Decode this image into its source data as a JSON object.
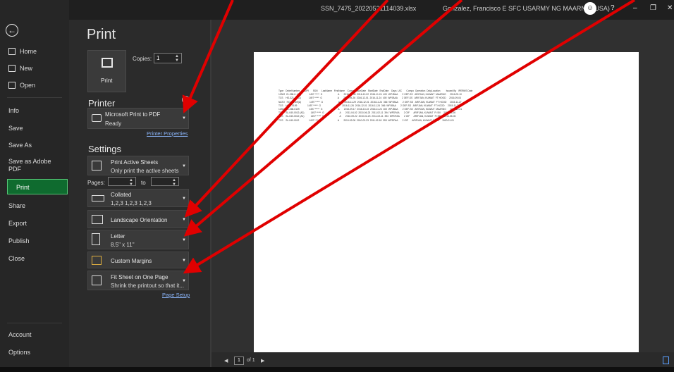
{
  "window": {
    "title": "SSN_7475_20220521114039.xlsx",
    "user": "Gonzalez, Francisco E SFC USARMY NG MAARNG (USA)",
    "help": "?",
    "minimize": "–",
    "restore": "❐",
    "close": "✕"
  },
  "nav": {
    "back": "←",
    "home": "Home",
    "new": "New",
    "open": "Open",
    "info": "Info",
    "save": "Save",
    "save_as": "Save As",
    "save_adobe": "Save as Adobe PDF",
    "print": "Print",
    "share": "Share",
    "export": "Export",
    "publish": "Publish",
    "close": "Close",
    "account": "Account",
    "options": "Options"
  },
  "print": {
    "heading": "Print",
    "button_label": "Print",
    "copies_label": "Copies:",
    "copies_value": "1",
    "printer_section": "Printer",
    "printer_name": "Microsoft Print to PDF",
    "printer_status": "Ready",
    "printer_properties": "Printer Properties",
    "settings_section": "Settings",
    "sheets_title": "Print Active Sheets",
    "sheets_sub": "Only print the active sheets",
    "pages_label": "Pages:",
    "to_label": "to",
    "collate_title": "Collated",
    "collate_sub": "1,2,3   1,2,3   1,2,3",
    "orientation": "Landscape Orientation",
    "paper_title": "Letter",
    "paper_sub": "8.5\" x 11\"",
    "margins": "Custom Margins",
    "scale_title": "Fit Sheet on One Page",
    "scale_sub": "Shrink the printout so that it...",
    "page_setup": "Page Setup"
  },
  "preview": {
    "table_text": "Type   OrderNumber     EDIPI      SSN      LastName   FirstName    Currcy  IssueDate   StartDate   EndDate    Days  UIC       Compo  Operation  DutyLocation         Issued By   IPERMS Date\n12302  21-268-0..(A1)            1497 *****  G                        A       2016-09-08  2016-10-22  2016-11-24  400  WPJBAA       2 OEF-SS   ARIFJAN, KUWAIT  MAARNG      2016-09-10\nTCS    HO-321-...(A1)            1497 *****  G                        A       2016-09-26  2016-12-01  2016-11-24  400  WPJBAA       2 OEF-SS   ARIFJAN, KUWAIT  FT HOOD     2016-09-04\nNATO   HO-...0109(A)             1497 *****  G                        A       2016-11-29  2016-12-01  2016-11-24  366  WPJBAA       2 OEF-SS   ARIFJAN, KUWAIT  FT HOOD     2015-11-27\nTCS    HO-...0109                1497 *****  G                        A       2016-11-26  2016-12-01  2016-11-24  366  WPJBAA       2 OEF-SS   ARIFJAN, KUWAIT  FT HOOD     2015-11-27\n12302  21-268-0139               1497 *****  G                        A       2015-09-17  2016-10-22  2016-11-24  400  WPJBAA       2 OEF-SS   ARIFJAN, KUWAIT  MAARNG      2015-10-21\nTCS    SL-040-0012 (A2)          1497 *****  G                        A       2011-04-02  2010-06-23  2011-02-11  394  WPDFAA       2 OIF      ARIFJAN, KUWAIT  Ft Sill     2016-05-06\nTCS    SL-040-0012 (A1)          1497 *****  G                        A       2010-09-22  2010-02-23  2011-02-11  394  WPDFAA       2 OIF      ARIFJAN, KUWAIT  Ft Sill     2016-05-06\nTCS    SL-040-0012               1497 *****  G                        A       2010-02-08  2010-02-23  2011-02-18  353  WPDFAA       2 OIF      ARIFJAN, KUWAIT  Ft Sill     1900-01-01",
    "page_current": "1",
    "page_of": "of 1"
  },
  "colors": {
    "arrow": "#e00000",
    "selected_nav": "#0f6b2f"
  }
}
